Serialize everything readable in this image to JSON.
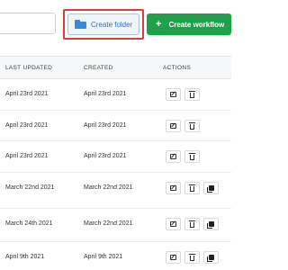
{
  "toolbar": {
    "search_value": "",
    "create_folder_label": "Create folder",
    "create_workflow_label": "Create workflow",
    "highlight_color": "#e03b3b",
    "workflow_button_color": "#21a04a",
    "folder_icon": "folder-icon",
    "plus_icon": "plus-icon"
  },
  "table": {
    "headers": {
      "last_updated": "LAST UPDATED",
      "created": "CREATED",
      "actions": "ACTIONS"
    },
    "rows": [
      {
        "last_updated": "April 23rd 2021",
        "created": "April 23rd 2021",
        "actions": [
          "edit-icon",
          "trash-icon"
        ]
      },
      {
        "last_updated": "April 23rd 2021",
        "created": "April 23rd 2021",
        "actions": [
          "edit-icon",
          "trash-icon"
        ]
      },
      {
        "last_updated": "April 23rd 2021",
        "created": "April 23rd 2021",
        "actions": [
          "edit-icon",
          "trash-icon"
        ]
      },
      {
        "last_updated": "March 22nd 2021",
        "created": "March 22nd 2021",
        "actions": [
          "edit-icon",
          "trash-icon",
          "copy-icon"
        ]
      },
      {
        "last_updated": "March 24th 2021",
        "created": "March 22nd 2021",
        "actions": [
          "edit-icon",
          "trash-icon",
          "copy-icon"
        ]
      },
      {
        "last_updated": "April 9th 2021",
        "created": "April 9th 2021",
        "actions": [
          "edit-icon",
          "trash-icon",
          "copy-icon"
        ]
      }
    ]
  }
}
